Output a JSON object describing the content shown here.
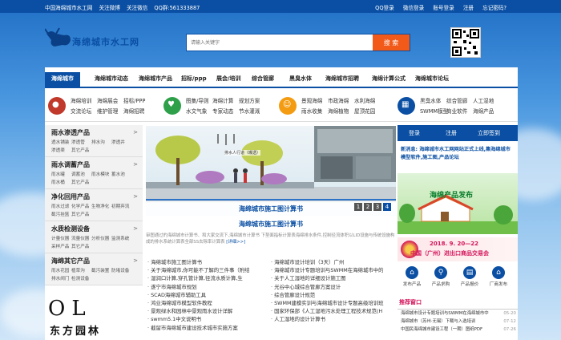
{
  "topbar": {
    "left": [
      "中国海绵城市水工网",
      "关注微博",
      "关注微信",
      "QQ群:561333887"
    ],
    "right": [
      "QQ登录",
      "微信登录",
      "账号登录",
      "注册",
      "忘记密码?"
    ]
  },
  "header": {
    "logo_text": "海绵城市水工网",
    "search_placeholder": "请输入关键字",
    "search_button": "搜 索"
  },
  "nav": [
    "海绵城市",
    "海绵城市动态",
    "海绵城市产品",
    "招标/ppp",
    "展会/培训",
    "综合管廊",
    "黑臭水体",
    "海绵城市招聘",
    "海绵计算公式",
    "海绵城市论坛"
  ],
  "categories": [
    {
      "icon": "chat-icon",
      "color": "#c0392b",
      "links": [
        "海绵培训",
        "海绵展会",
        "招标/PPP",
        "交流论坛",
        "维护管理",
        "海绵招聘"
      ]
    },
    {
      "icon": "heart-icon",
      "color": "#2ea04a",
      "links": [
        "图集/导则",
        "海绵计算",
        "规划方案",
        "水文气象",
        "专家动态",
        "节水灌溉"
      ]
    },
    {
      "icon": "user-icon",
      "color": "#f39c12",
      "links": [
        "景观海绵",
        "市政海绵",
        "水利海绵",
        "雨水收集",
        "海绵植物",
        "屋顶花园"
      ]
    },
    {
      "icon": "grid-icon",
      "color": "#0a4fa3",
      "links": [
        "黑臭水体",
        "综合管廊",
        "人工湿地",
        "SWMM模型",
        "商业软件",
        "海绵产品"
      ]
    }
  ],
  "left_sections": [
    {
      "title": "雨水渗透产品",
      "subs": [
        "透水铺装",
        "渗透管",
        "排水沟",
        "渗透井",
        "渗透渠",
        "其它产品"
      ]
    },
    {
      "title": "雨水调蓄产品",
      "subs": [
        "雨水罐",
        "调蓄池",
        "雨水模块",
        "蓄水池",
        "雨水桶",
        "其它产品"
      ]
    },
    {
      "title": "净化回用产品",
      "subs": [
        "雨水过滤",
        "化学产品",
        "生物净化",
        "初期弃流",
        "截污挂篮",
        "其它产品"
      ]
    },
    {
      "title": "水质检测设备",
      "subs": [
        "计量仪器",
        "流量仪器",
        "分析仪器",
        "监测系统",
        "采样产品",
        "其它产品"
      ]
    },
    {
      "title": "海绵其它产品",
      "subs": [
        "雨水花园",
        "植草沟",
        "截污装置",
        "防堵设备",
        "排水阀门",
        "检测设备"
      ]
    }
  ],
  "brand": {
    "logo": "OL",
    "name": "东方园林"
  },
  "slider": {
    "caption": "海绵城市施工图计算书",
    "pages": [
      "1",
      "2",
      "3",
      "4"
    ],
    "active": 3,
    "tag": "排水人行道（曝透）"
  },
  "headline": "海绵城市施工图计算书",
  "intro": {
    "text": "审图通过的海绵城市计算书、和大家交流下,海绵城市计算书 下垫面指标计算表海绵排水条件,控制径流体积以LID设施与传统设施构成的排水系统计算表全部SS去除率计算表",
    "more": "[详细>>]"
  },
  "news_left": [
    "海绵城市施工图计算书",
    "关于海绵城市,你可能不了解的三件事（附结",
    "湿润口计算,穿孔管计算,径流水质计算,生",
    "遂宁市海绵城市规划",
    "SCAD海绵城市辅助工具",
    "鸿业海绵城市模型软件教程",
    "景观绿水和园林中景观雨水设计详解",
    "swmm5.1中文说明书",
    "截留市海绵城市建设技术城市实施方案"
  ],
  "news_right": [
    "海绵城市设计培训（3天）广州",
    "海绵城市设计专题培训与SWMM在海绵城市中的",
    "关于人工湿地的详细设计施工图",
    "光谷中心城综合管廊方案设计",
    "综合管廊设计规范",
    "SWMM建模实训与海绵城市设计专题高级培训班",
    "国家环保部《人工湿地污水处理工程技术规范(H",
    "人工湿地的设计计算书"
  ],
  "auth": [
    "登录",
    "注册",
    "立即签到"
  ],
  "notice": "新消息: 海绵城市水工网网站正式上线,集海绵城市模型软件,施工图,产品论坛",
  "promo1": {
    "title": "海绵产品发布"
  },
  "promo2": {
    "date": "2018. 9. 20—22",
    "event": "中国（广州）进出口商品交易会"
  },
  "quick": [
    {
      "icon": "publish-icon",
      "label": "发布产品"
    },
    {
      "icon": "search-icon",
      "label": "产品求购"
    },
    {
      "icon": "report-icon",
      "label": "产品报价"
    },
    {
      "icon": "home-icon",
      "label": "厂商发布"
    }
  ],
  "recommend": {
    "title": "推荐窗口",
    "rows": [
      {
        "text": "海绵城市设计专题培训与SWMM在海绵城市中",
        "date": "05-20"
      },
      {
        "text": "海绵城市（苏州·无锡）下载与入选培训",
        "date": "07-12"
      },
      {
        "text": "中国民海绵城市建设工程（一期）图纸PDF",
        "date": "07-26"
      }
    ]
  }
}
